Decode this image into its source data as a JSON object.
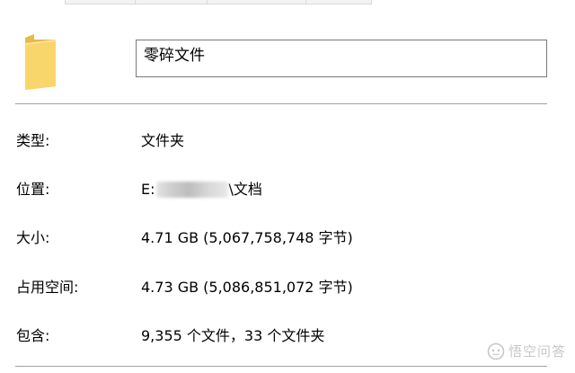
{
  "name_field": {
    "value": "零碎文件"
  },
  "properties": [
    {
      "label": "类型:",
      "value": "文件夹"
    },
    {
      "label": "位置:",
      "value_prefix": "E:",
      "value_suffix": "\\文档"
    },
    {
      "label": "大小:",
      "value": "4.71 GB (5,067,758,748 字节)"
    },
    {
      "label": "占用空间:",
      "value": "4.73 GB (5,086,851,072 字节)"
    },
    {
      "label": "包含:",
      "value": "9,355 个文件，33 个文件夹"
    }
  ],
  "watermark": {
    "text": "悟空问答"
  },
  "colors": {
    "folder_front": "#f9d66b",
    "folder_back": "#e8b84b",
    "border": "#7a7a7a",
    "divider": "#a0a0a0"
  }
}
